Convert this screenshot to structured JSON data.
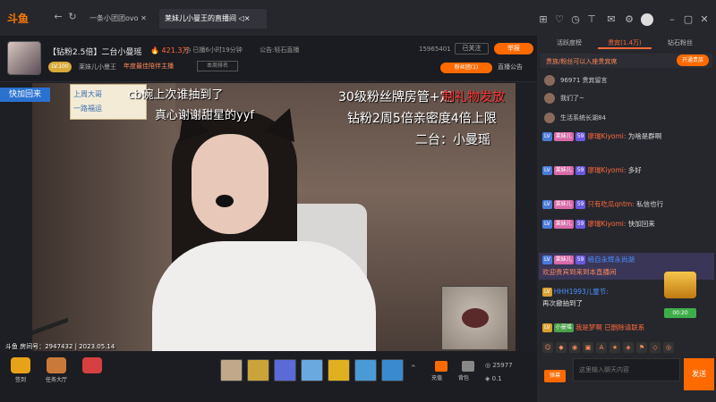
{
  "app": {
    "logo": "斗鱼"
  },
  "tabs": [
    {
      "label": "一条小团团ovo"
    },
    {
      "label": "莱妹儿小曼王的直播间"
    }
  ],
  "room": {
    "title": "【钻粉2.5倍】二台小曼瑶",
    "heat": "421.3万",
    "live_time": "已播6小时19分钟",
    "notice": "公告:轻石直播",
    "room_id": "15965401",
    "follow_label": "已关注",
    "report_label": "举报",
    "level": "LV.100",
    "streamer": "莱妹儿小曼王",
    "category": "年度最佳陪伴主播",
    "rank_btn": "本周排名",
    "fans_badge": "粉丝团(1)",
    "live_notice": "直播公告"
  },
  "video": {
    "quick_back": "快加回来",
    "overlay_card": "上周大哥\n一路福运",
    "overlay_l1": "cb碗上次谁抽到了",
    "overlay_l2": "真心谢谢甜星的yyf",
    "overlay_r1": "30级粉丝牌房管+定",
    "overlay_r1_red": "制礼物发放",
    "overlay_r2": "钻粉2周5倍亲密度4倍上限",
    "overlay_r3": "二台：小曼瑶",
    "footer": "斗鱼 房间号：2947432 | 2023.05.14"
  },
  "bottom": {
    "items": [
      {
        "label": "签到"
      },
      {
        "label": "任务大厅"
      },
      {
        "label": ""
      }
    ],
    "charge": "充值",
    "backpack": "背包",
    "fish_balls": "25977",
    "yuwan": "0.1"
  },
  "panel": {
    "tabs": [
      "活跃度榜",
      "贵宾(1.4万)",
      "钻石粉丝"
    ],
    "noble_text": "贵族/粉丝可以入座贵宾席",
    "open_noble": "开通贵族",
    "ranks": [
      {
        "num": "96971",
        "name": "贵宾留言"
      },
      {
        "num": "",
        "name": "我们了~"
      },
      {
        "num": "",
        "name": "生活系统长湖84"
      }
    ],
    "messages": [
      {
        "badge": "LV",
        "fans": "莱妹儿",
        "lv2": "59",
        "user": "廖瑞Kiyomi:",
        "text": "为啥是群啊"
      },
      {
        "badge": "LV",
        "fans": "莱妹儿",
        "lv2": "59",
        "user": "廖瑞Kiyomi:",
        "text": "多好"
      },
      {
        "badge": "LV",
        "fans": "莱妹儿",
        "lv2": "59",
        "user": "只有吃瓜qntm:",
        "text": "私信也行"
      },
      {
        "badge": "LV",
        "fans": "莱妹儿",
        "lv2": "59",
        "user": "廖瑞Kiyomi:",
        "text": "快加回来"
      },
      {
        "badge": "LV",
        "fans": "莱妹儿",
        "lv2": "59",
        "user": "楠自永辉永尚湖",
        "text": ""
      },
      {
        "badge": "",
        "fans": "",
        "lv2": "",
        "user": "",
        "text": "欢迎贵宾到来到本直播间"
      },
      {
        "badge": "LV",
        "fans": "",
        "lv2": "",
        "user": "HHH1993儿童节:",
        "text": "再次撤抽到了"
      },
      {
        "badge": "LV",
        "fans": "小曼瑶",
        "lv2": "",
        "user": "我是梦啊 已删除请联系",
        "text": ""
      }
    ],
    "chest_time": "00:20",
    "input_placeholder": "这里输入聊天内容",
    "send": "发送",
    "wave": "弹幕"
  }
}
